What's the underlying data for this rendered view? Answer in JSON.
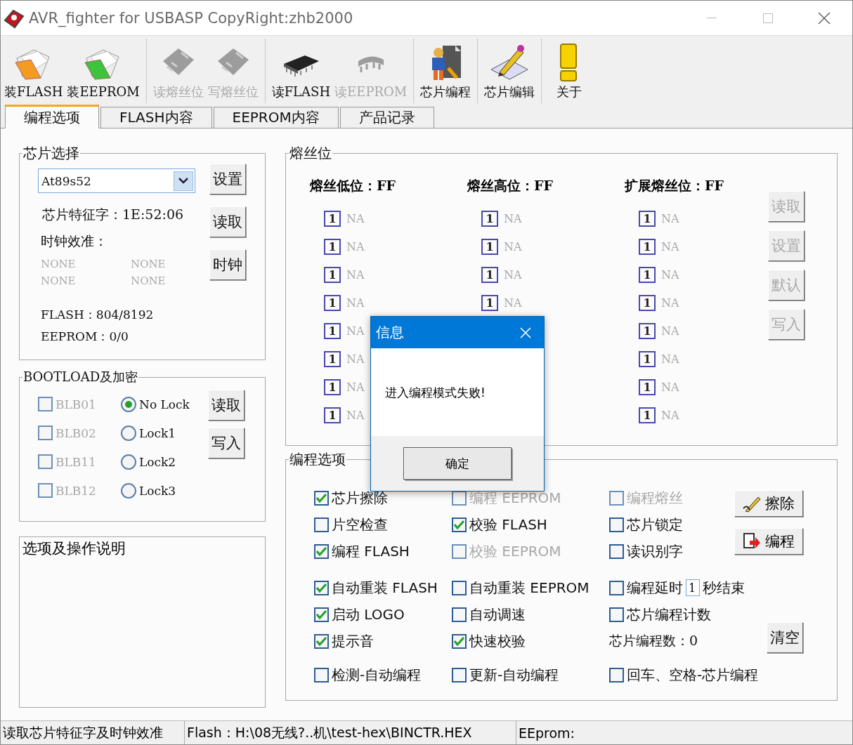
{
  "window": {
    "title": "AVR_fighter for USBASP CopyRight:zhb2000"
  },
  "toolbar_groups": [
    [
      {
        "label": "装FLASH",
        "kind": "folder",
        "disabled": false
      },
      {
        "label": "装EEPROM",
        "kind": "folder",
        "disabled": false
      }
    ],
    [
      {
        "label": "读熔丝位",
        "kind": "fuse",
        "disabled": true
      },
      {
        "label": "写熔丝位",
        "kind": "fuse",
        "disabled": true
      }
    ],
    [
      {
        "label": "读FLASH",
        "kind": "chip",
        "disabled": false
      },
      {
        "label": "读EEPROM",
        "kind": "minichip",
        "disabled": true
      }
    ],
    [
      {
        "label": "芯片编程",
        "kind": "worker",
        "disabled": false
      }
    ],
    [
      {
        "label": "芯片编辑",
        "kind": "pencil",
        "disabled": false
      }
    ],
    [
      {
        "label": "关于",
        "kind": "exclamation",
        "disabled": false
      }
    ]
  ],
  "tabs": [
    {
      "label": "编程选项",
      "selected": true
    },
    {
      "label": "FLASH内容",
      "selected": false
    },
    {
      "label": "EEPROM内容",
      "selected": false
    },
    {
      "label": "产品记录",
      "selected": false
    }
  ],
  "chip_select": {
    "title": "芯片选择",
    "chip": "At89s52",
    "signature": "芯片特征字：1E:52:06",
    "clock_label": "时钟效准：",
    "clock_values": [
      "NONE",
      "NONE",
      "NONE",
      "NONE"
    ],
    "flash": "FLASH：804/8192",
    "eeprom": "EEPROM：0/0",
    "buttons": [
      "设置",
      "读取",
      "时钟"
    ]
  },
  "bootload": {
    "title": "BOOTLOAD及加密",
    "bits": [
      {
        "label": "BLB01",
        "checked": false,
        "disabled": true
      },
      {
        "label": "BLB02",
        "checked": false,
        "disabled": true
      },
      {
        "label": "BLB11",
        "checked": false,
        "disabled": true
      },
      {
        "label": "BLB12",
        "checked": false,
        "disabled": true
      }
    ],
    "locks": [
      {
        "label": "No Lock",
        "selected": true
      },
      {
        "label": "Lock1",
        "selected": false
      },
      {
        "label": "Lock2",
        "selected": false
      },
      {
        "label": "Lock3",
        "selected": false
      }
    ],
    "buttons": [
      "读取",
      "写入"
    ]
  },
  "notes": {
    "title": "选项及操作说明"
  },
  "fuses": {
    "title": "熔丝位",
    "columns": [
      {
        "heading": "熔丝低位：FF",
        "bits": [
          {
            "value": "1",
            "label": "NA"
          },
          {
            "value": "1",
            "label": "NA"
          },
          {
            "value": "1",
            "label": "NA"
          },
          {
            "value": "1",
            "label": "NA"
          },
          {
            "value": "1",
            "label": "NA"
          },
          {
            "value": "1",
            "label": "NA"
          },
          {
            "value": "1",
            "label": "NA"
          },
          {
            "value": "1",
            "label": "NA"
          }
        ]
      },
      {
        "heading": "熔丝高位：FF",
        "bits": [
          {
            "value": "1",
            "label": "NA"
          },
          {
            "value": "1",
            "label": "NA"
          },
          {
            "value": "1",
            "label": "NA"
          },
          {
            "value": "1",
            "label": "NA"
          }
        ]
      },
      {
        "heading": "扩展熔丝位：FF",
        "bits": [
          {
            "value": "1",
            "label": "NA"
          },
          {
            "value": "1",
            "label": "NA"
          },
          {
            "value": "1",
            "label": "NA"
          },
          {
            "value": "1",
            "label": "NA"
          },
          {
            "value": "1",
            "label": "NA"
          },
          {
            "value": "1",
            "label": "NA"
          },
          {
            "value": "1",
            "label": "NA"
          },
          {
            "value": "1",
            "label": "NA"
          }
        ]
      }
    ],
    "buttons": [
      {
        "label": "读取",
        "disabled": true
      },
      {
        "label": "设置",
        "disabled": true
      },
      {
        "label": "默认",
        "disabled": true
      },
      {
        "label": "写入",
        "disabled": true
      }
    ]
  },
  "options": {
    "title": "编程选项",
    "rows": [
      [
        {
          "kind": "check",
          "label": "芯片擦除",
          "checked": true,
          "disabled": false
        },
        {
          "kind": "check",
          "label": "编程 EEPROM",
          "checked": false,
          "disabled": true
        },
        {
          "kind": "check",
          "label": "编程熔丝",
          "checked": false,
          "disabled": true
        }
      ],
      [
        {
          "kind": "check",
          "label": "片空检查",
          "checked": false,
          "disabled": false
        },
        {
          "kind": "check",
          "label": "校验 FLASH",
          "checked": true,
          "disabled": false
        },
        {
          "kind": "check",
          "label": "芯片锁定",
          "checked": false,
          "disabled": false
        }
      ],
      [
        {
          "kind": "check",
          "label": "编程 FLASH",
          "checked": true,
          "disabled": false
        },
        {
          "kind": "check",
          "label": "校验 EEPROM",
          "checked": false,
          "disabled": true
        },
        {
          "kind": "check",
          "label": "读识别字",
          "checked": false,
          "disabled": false
        }
      ],
      [
        {
          "kind": "check",
          "label": "自动重装 FLASH",
          "checked": true,
          "disabled": false
        },
        {
          "kind": "check",
          "label": "自动重装 EEPROM",
          "checked": false,
          "disabled": false
        },
        {
          "kind": "delay",
          "label": "编程延时",
          "value": "1",
          "suffix": "秒结束",
          "checked": false,
          "disabled": false
        }
      ],
      [
        {
          "kind": "check",
          "label": "启动 LOGO",
          "checked": true,
          "disabled": false
        },
        {
          "kind": "check",
          "label": "自动调速",
          "checked": false,
          "disabled": false
        },
        {
          "kind": "check",
          "label": "芯片编程计数",
          "checked": false,
          "disabled": false
        }
      ],
      [
        {
          "kind": "check",
          "label": "提示音",
          "checked": true,
          "disabled": false
        },
        {
          "kind": "check",
          "label": "快速校验",
          "checked": true,
          "disabled": false
        },
        {
          "kind": "text",
          "label": "芯片编程数：0"
        }
      ],
      [
        {
          "kind": "check",
          "label": "检测-自动编程",
          "checked": false,
          "disabled": false
        },
        {
          "kind": "check",
          "label": "更新-自动编程",
          "checked": false,
          "disabled": false
        },
        {
          "kind": "check",
          "label": "回车、空格-芯片编程",
          "checked": false,
          "disabled": false
        }
      ]
    ],
    "buttons": [
      {
        "label": "擦除",
        "kind": "erase"
      },
      {
        "label": "编程",
        "kind": "program"
      }
    ],
    "clear_button": "清空"
  },
  "dialog": {
    "title": "信息",
    "message": "进入编程模式失败!",
    "button": "确定"
  },
  "status_bar": [
    "读取芯片特征字及时钟效准",
    "Flash：H:\\08无线?..机\\test-hex\\BINCTR.HEX",
    "EEprom:"
  ]
}
